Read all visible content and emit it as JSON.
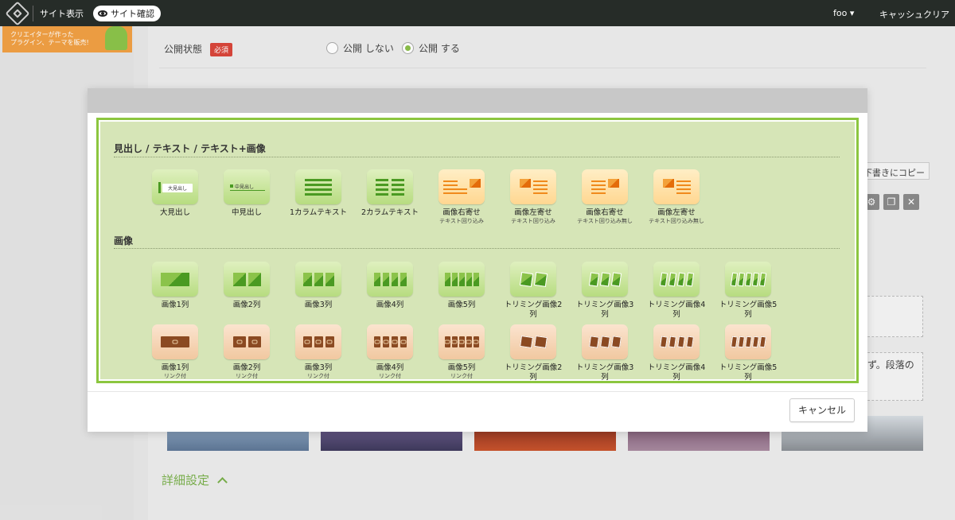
{
  "topbar": {
    "site_view": "サイト表示",
    "site_check": "サイト確認",
    "user": "foo ▾",
    "cache_clear": "キャッシュクリア"
  },
  "banner": {
    "line1": "クリエイターが作った",
    "line2": "プラグイン、テーマを販売!"
  },
  "background": {
    "publish_label": "公開状態",
    "required_badge": "必須",
    "radio_off": "公開 しない",
    "radio_on": "公開 する",
    "copy_button": "下書きにコピー",
    "snippet": "ず。段落の",
    "detail": "詳細設定"
  },
  "modal": {
    "section1_title": "見出し / テキスト / テキスト+画像",
    "section2_title": "画像",
    "row1": [
      {
        "label": "大見出し",
        "sub": ""
      },
      {
        "label": "中見出し",
        "sub": ""
      },
      {
        "label": "1カラムテキスト",
        "sub": ""
      },
      {
        "label": "2カラムテキスト",
        "sub": ""
      },
      {
        "label": "画像右寄せ",
        "sub": "テキスト回り込み"
      },
      {
        "label": "画像左寄せ",
        "sub": "テキスト回り込み"
      },
      {
        "label": "画像右寄せ",
        "sub": "テキスト回り込み無し"
      },
      {
        "label": "画像左寄せ",
        "sub": "テキスト回り込み無し"
      }
    ],
    "row1_tile_text": {
      "large": "大見出し",
      "medium": "中見出し"
    },
    "row2": [
      {
        "label": "画像1列"
      },
      {
        "label": "画像2列"
      },
      {
        "label": "画像3列"
      },
      {
        "label": "画像4列"
      },
      {
        "label": "画像5列"
      },
      {
        "label": "トリミング画像2列"
      },
      {
        "label": "トリミング画像3列"
      },
      {
        "label": "トリミング画像4列"
      },
      {
        "label": "トリミング画像5列"
      }
    ],
    "row3": [
      {
        "label": "画像1列",
        "sub": "リンク付"
      },
      {
        "label": "画像2列",
        "sub": "リンク付"
      },
      {
        "label": "画像3列",
        "sub": "リンク付"
      },
      {
        "label": "画像4列",
        "sub": "リンク付"
      },
      {
        "label": "画像5列",
        "sub": "リンク付"
      },
      {
        "label": "トリミング画像2列",
        "sub": ""
      },
      {
        "label": "トリミング画像3列",
        "sub": ""
      },
      {
        "label": "トリミング画像4列",
        "sub": ""
      },
      {
        "label": "トリミング画像5列",
        "sub": ""
      }
    ],
    "cancel": "キャンセル"
  }
}
